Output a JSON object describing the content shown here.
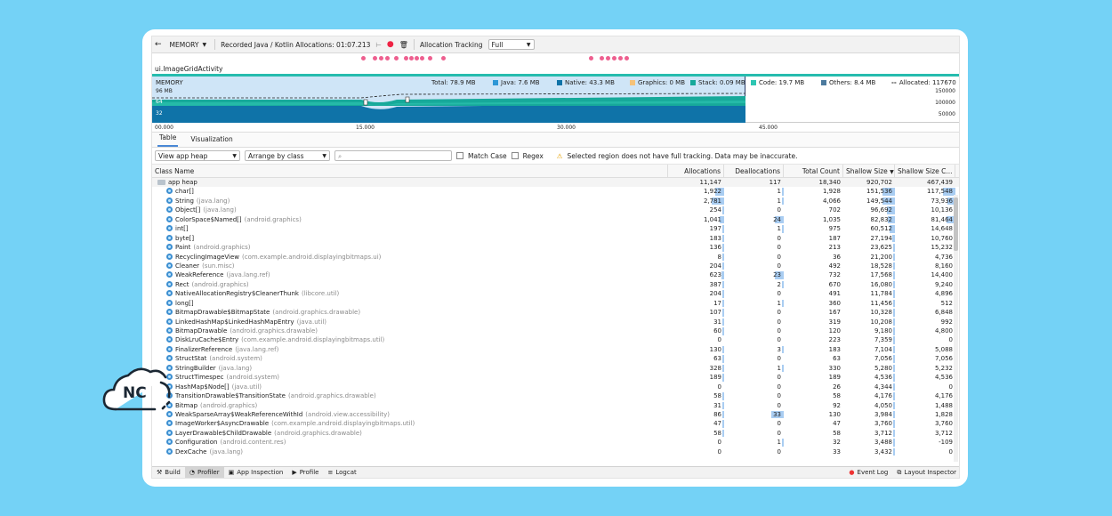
{
  "toolbar": {
    "back_glyph": "←",
    "profiler_select": "MEMORY",
    "recording_label": "Recorded Java / Kotlin Allocations: 01:07.213",
    "allocation_tracking_label": "Allocation Tracking",
    "allocation_tracking_value": "Full"
  },
  "activity_label": "ui.ImageGridActivity",
  "memory_chart": {
    "title": "MEMORY",
    "scale_label": "96 MB",
    "y_mid_label": "64",
    "y_low_label": "32",
    "right_axis": [
      "150000",
      "100000",
      "50000"
    ],
    "legend": [
      {
        "label": "Total: 78.9 MB",
        "color": ""
      },
      {
        "label": "Java: 7.6 MB",
        "color": "#2e97d6"
      },
      {
        "label": "Native: 43.3 MB",
        "color": "#0f73a8"
      },
      {
        "label": "Graphics: 0 MB",
        "color": "#f5c279"
      },
      {
        "label": "Stack: 0.09 MB",
        "color": "#17a99a"
      },
      {
        "label": "Code: 19.7 MB",
        "color": "#2ec6b3"
      },
      {
        "label": "Others: 8.4 MB",
        "color": "#4c7a9e"
      },
      {
        "label": "Allocated: 117670",
        "color": "#333333"
      }
    ],
    "time_ticks": [
      "00.000",
      "15.000",
      "30.000",
      "45.000"
    ]
  },
  "tabs": [
    "Table",
    "Visualization"
  ],
  "filter": {
    "heap_select": "View app heap",
    "arrange_select": "Arrange by class",
    "search_placeholder": "",
    "match_case": "Match Case",
    "regex": "Regex",
    "warning": "Selected region does not have full tracking. Data may be inaccurate."
  },
  "table": {
    "columns": [
      "Class Name",
      "Allocations",
      "Deallocations",
      "Total Count",
      "Shallow Size",
      "Shallow Size C..."
    ],
    "rows": [
      {
        "name": "app heap",
        "pkg": "",
        "alloc": "11,147",
        "dealloc": "117",
        "total": "18,340",
        "shallow": "920,702",
        "shallowc": "467,439",
        "root": true
      },
      {
        "name": "char[]",
        "pkg": "",
        "alloc": "1,922",
        "dealloc": "1",
        "total": "1,928",
        "shallow": "151,536",
        "shallowc": "117,548"
      },
      {
        "name": "String",
        "pkg": "(java.lang)",
        "alloc": "2,781",
        "dealloc": "1",
        "total": "4,066",
        "shallow": "149,544",
        "shallowc": "73,936"
      },
      {
        "name": "Object[]",
        "pkg": "(java.lang)",
        "alloc": "254",
        "dealloc": "0",
        "total": "702",
        "shallow": "96,692",
        "shallowc": "10,136"
      },
      {
        "name": "ColorSpace$Named[]",
        "pkg": "(android.graphics)",
        "alloc": "1,041",
        "dealloc": "24",
        "total": "1,035",
        "shallow": "82,832",
        "shallowc": "81,464"
      },
      {
        "name": "int[]",
        "pkg": "",
        "alloc": "197",
        "dealloc": "1",
        "total": "975",
        "shallow": "60,512",
        "shallowc": "14,648"
      },
      {
        "name": "byte[]",
        "pkg": "",
        "alloc": "183",
        "dealloc": "0",
        "total": "187",
        "shallow": "27,194",
        "shallowc": "10,760"
      },
      {
        "name": "Paint",
        "pkg": "(android.graphics)",
        "alloc": "136",
        "dealloc": "0",
        "total": "213",
        "shallow": "23,625",
        "shallowc": "15,232"
      },
      {
        "name": "RecyclingImageView",
        "pkg": "(com.example.android.displayingbitmaps.ui)",
        "alloc": "8",
        "dealloc": "0",
        "total": "36",
        "shallow": "21,200",
        "shallowc": "4,736"
      },
      {
        "name": "Cleaner",
        "pkg": "(sun.misc)",
        "alloc": "204",
        "dealloc": "0",
        "total": "492",
        "shallow": "18,528",
        "shallowc": "8,160"
      },
      {
        "name": "WeakReference",
        "pkg": "(java.lang.ref)",
        "alloc": "623",
        "dealloc": "23",
        "total": "732",
        "shallow": "17,568",
        "shallowc": "14,400"
      },
      {
        "name": "Rect",
        "pkg": "(android.graphics)",
        "alloc": "387",
        "dealloc": "2",
        "total": "670",
        "shallow": "16,080",
        "shallowc": "9,240"
      },
      {
        "name": "NativeAllocationRegistry$CleanerThunk",
        "pkg": "(libcore.util)",
        "alloc": "204",
        "dealloc": "0",
        "total": "491",
        "shallow": "11,784",
        "shallowc": "4,896"
      },
      {
        "name": "long[]",
        "pkg": "",
        "alloc": "17",
        "dealloc": "1",
        "total": "360",
        "shallow": "11,456",
        "shallowc": "512"
      },
      {
        "name": "BitmapDrawable$BitmapState",
        "pkg": "(android.graphics.drawable)",
        "alloc": "107",
        "dealloc": "0",
        "total": "167",
        "shallow": "10,328",
        "shallowc": "6,848"
      },
      {
        "name": "LinkedHashMap$LinkedHashMapEntry",
        "pkg": "(java.util)",
        "alloc": "31",
        "dealloc": "0",
        "total": "319",
        "shallow": "10,208",
        "shallowc": "992"
      },
      {
        "name": "BitmapDrawable",
        "pkg": "(android.graphics.drawable)",
        "alloc": "60",
        "dealloc": "0",
        "total": "120",
        "shallow": "9,180",
        "shallowc": "4,800"
      },
      {
        "name": "DiskLruCache$Entry",
        "pkg": "(com.example.android.displayingbitmaps.util)",
        "alloc": "0",
        "dealloc": "0",
        "total": "223",
        "shallow": "7,359",
        "shallowc": "0"
      },
      {
        "name": "FinalizerReference",
        "pkg": "(java.lang.ref)",
        "alloc": "130",
        "dealloc": "3",
        "total": "183",
        "shallow": "7,104",
        "shallowc": "5,088"
      },
      {
        "name": "StructStat",
        "pkg": "(android.system)",
        "alloc": "63",
        "dealloc": "0",
        "total": "63",
        "shallow": "7,056",
        "shallowc": "7,056"
      },
      {
        "name": "StringBuilder",
        "pkg": "(java.lang)",
        "alloc": "328",
        "dealloc": "1",
        "total": "330",
        "shallow": "5,280",
        "shallowc": "5,232"
      },
      {
        "name": "StructTimespec",
        "pkg": "(android.system)",
        "alloc": "189",
        "dealloc": "0",
        "total": "189",
        "shallow": "4,536",
        "shallowc": "4,536"
      },
      {
        "name": "HashMap$Node[]",
        "pkg": "(java.util)",
        "alloc": "0",
        "dealloc": "0",
        "total": "26",
        "shallow": "4,344",
        "shallowc": "0"
      },
      {
        "name": "TransitionDrawable$TransitionState",
        "pkg": "(android.graphics.drawable)",
        "alloc": "58",
        "dealloc": "0",
        "total": "58",
        "shallow": "4,176",
        "shallowc": "4,176"
      },
      {
        "name": "Bitmap",
        "pkg": "(android.graphics)",
        "alloc": "31",
        "dealloc": "0",
        "total": "92",
        "shallow": "4,050",
        "shallowc": "1,488"
      },
      {
        "name": "WeakSparseArray$WeakReferenceWithId",
        "pkg": "(android.view.accessibility)",
        "alloc": "86",
        "dealloc": "33",
        "total": "130",
        "shallow": "3,984",
        "shallowc": "1,828"
      },
      {
        "name": "ImageWorker$AsyncDrawable",
        "pkg": "(com.example.android.displayingbitmaps.util)",
        "alloc": "47",
        "dealloc": "0",
        "total": "47",
        "shallow": "3,760",
        "shallowc": "3,760"
      },
      {
        "name": "LayerDrawable$ChildDrawable",
        "pkg": "(android.graphics.drawable)",
        "alloc": "58",
        "dealloc": "0",
        "total": "58",
        "shallow": "3,712",
        "shallowc": "3,712"
      },
      {
        "name": "Configuration",
        "pkg": "(android.content.res)",
        "alloc": "0",
        "dealloc": "1",
        "total": "32",
        "shallow": "3,488",
        "shallowc": "-109"
      },
      {
        "name": "DexCache",
        "pkg": "(java.lang)",
        "alloc": "0",
        "dealloc": "0",
        "total": "33",
        "shallow": "3,432",
        "shallowc": "0"
      }
    ]
  },
  "statusbar": {
    "left": [
      "Build",
      "Profiler",
      "App Inspection",
      "Profile",
      "Logcat"
    ],
    "right": [
      "Event Log",
      "Layout Inspector"
    ]
  },
  "logo_text": "NC"
}
